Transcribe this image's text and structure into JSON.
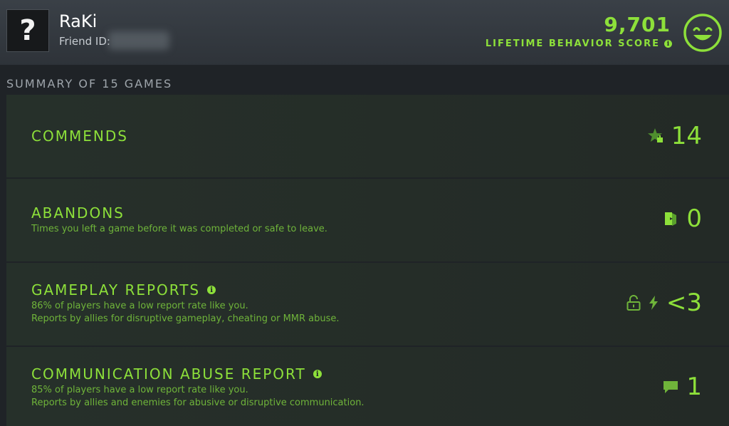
{
  "player": {
    "avatar_glyph": "?",
    "name": "RaKi",
    "friend_id_label": "Friend ID:"
  },
  "behavior": {
    "score": "9,701",
    "label": "LIFETIME BEHAVIOR SCORE",
    "info_glyph": "i"
  },
  "summary": {
    "title": "SUMMARY OF 15 GAMES"
  },
  "stats": {
    "commends": {
      "title": "COMMENDS",
      "value": "14",
      "icon": "star-thumb-icon"
    },
    "abandons": {
      "title": "ABANDONS",
      "desc": "Times you left a game before it was completed or safe to leave.",
      "value": "0",
      "icon": "exit-door-icon"
    },
    "gameplay": {
      "title": "GAMEPLAY REPORTS",
      "info_glyph": "i",
      "desc1": "86% of players have a low report rate like you.",
      "desc2": "Reports by allies for disruptive gameplay, cheating or MMR abuse.",
      "value": "<3",
      "icons": [
        "unlock-icon",
        "lightning-icon"
      ]
    },
    "communication": {
      "title": "COMMUNICATION ABUSE REPORT",
      "info_glyph": "i",
      "desc1": "85% of players have a low report rate like you.",
      "desc2": "Reports by allies and enemies for abusive or disruptive communication.",
      "value": "1",
      "icon": "chat-bubble-icon"
    }
  },
  "colors": {
    "accent": "#8de03a",
    "header_bg": "#353b41",
    "row_bg": "#26302a",
    "page_bg": "#1f2327"
  }
}
